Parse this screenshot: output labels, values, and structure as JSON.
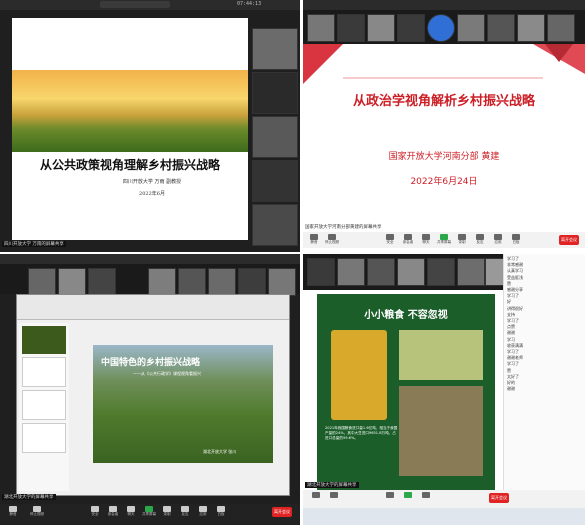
{
  "q1": {
    "slide_title": "从公共政策视角理解乡村振兴战略",
    "affiliation": "四川开放大学  万雨  副教授",
    "date": "2022年6月",
    "share_label": "四川开放大学 万雨的屏幕共享",
    "time": "07:44:13"
  },
  "q2": {
    "slide_title": "从政治学视角解析乡村振兴战略",
    "affiliation": "国家开放大学河南分部  黄建",
    "date": "2022年6月24日",
    "share_label": "国家开放大学河南分部黄建的屏幕共享",
    "leave_label": "离开会议"
  },
  "q3": {
    "slide_title": "中国特色的乡村振兴战略",
    "slide_subtitle": "——从《公共行政学》课程视角看振兴",
    "affiliation": "湖北开放大学  张川",
    "share_label": "湖北开放大学的屏幕共享",
    "leave_label": "离开会议"
  },
  "q4": {
    "slide_title": "小小粮食  不容忽视",
    "body_text": "2021年我国粮食进口量1.6亿吨，相当于我国产量的24%，其中大豆进口9651.8万吨，占进口总量的59.6%。",
    "share_label": "湖北开放大学的屏幕共享",
    "leave_label": "离开会议",
    "chat": [
      "学习了",
      "非常感谢",
      "认真学习",
      "受益匪浅",
      "赞",
      "感谢分享",
      "学习了",
      "好",
      "讲得很好",
      "支持",
      "学习了",
      "点赞",
      "谢谢",
      "学习",
      "收获满满",
      "学习了",
      "谢谢老师",
      "学习了",
      "赞",
      "太好了",
      "好的",
      "谢谢"
    ]
  },
  "toolbar_labels": [
    "静音",
    "停止视频",
    "安全",
    "参会者",
    "聊天",
    "共享屏幕",
    "录制",
    "反应",
    "应用",
    "白板"
  ]
}
